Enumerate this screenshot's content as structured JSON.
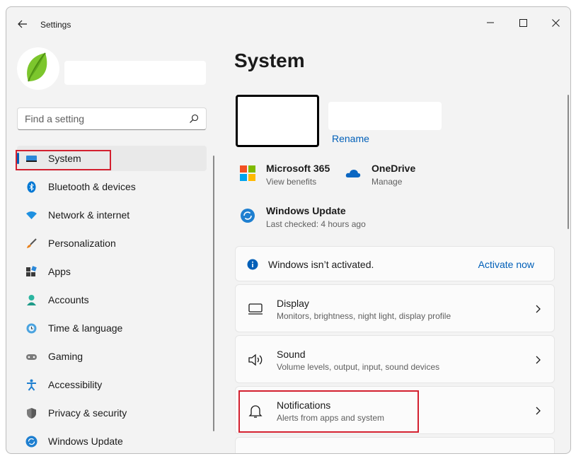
{
  "window": {
    "title": "Settings"
  },
  "search": {
    "placeholder": "Find a setting"
  },
  "nav": {
    "items": [
      {
        "label": "System"
      },
      {
        "label": "Bluetooth & devices"
      },
      {
        "label": "Network & internet"
      },
      {
        "label": "Personalization"
      },
      {
        "label": "Apps"
      },
      {
        "label": "Accounts"
      },
      {
        "label": "Time & language"
      },
      {
        "label": "Gaming"
      },
      {
        "label": "Accessibility"
      },
      {
        "label": "Privacy & security"
      },
      {
        "label": "Windows Update"
      }
    ],
    "active_index": 0
  },
  "main": {
    "title": "System",
    "rename": "Rename",
    "quick": [
      {
        "title": "Microsoft 365",
        "subtitle": "View benefits",
        "icon": "microsoft-365-icon"
      },
      {
        "title": "OneDrive",
        "subtitle": "Manage",
        "icon": "onedrive-icon"
      },
      {
        "title": "Windows Update",
        "subtitle": "Last checked: 4 hours ago",
        "icon": "windows-update-icon"
      }
    ],
    "activation": {
      "text": "Windows isn’t activated.",
      "link": "Activate now"
    },
    "cards": [
      {
        "title": "Display",
        "subtitle": "Monitors, brightness, night light, display profile",
        "icon": "monitor-icon"
      },
      {
        "title": "Sound",
        "subtitle": "Volume levels, output, input, sound devices",
        "icon": "speaker-icon"
      },
      {
        "title": "Notifications",
        "subtitle": "Alerts from apps and system",
        "icon": "bell-icon"
      }
    ]
  },
  "colors": {
    "accent": "#005fb8",
    "highlight": "#d3202f"
  }
}
